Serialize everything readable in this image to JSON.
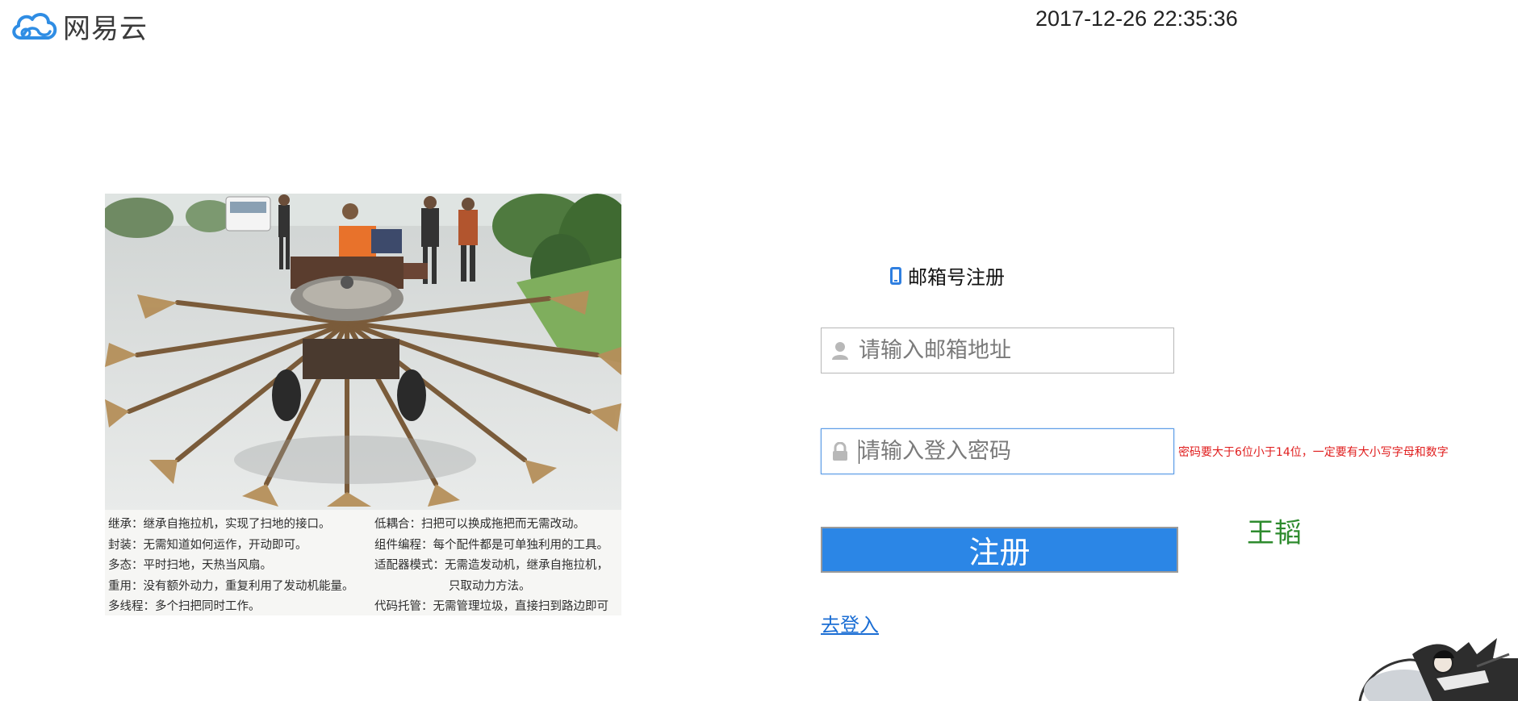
{
  "header": {
    "logo_icon": "cloud-logo-icon",
    "brand": "网易云",
    "datetime": "2017-12-26 22:35:36"
  },
  "meme": {
    "caption_left": [
      "继承：继承自拖拉机，实现了扫地的接口。",
      "封装：无需知道如何运作，开动即可。",
      "多态：平时扫地，天热当风扇。",
      "重用：没有额外动力，重复利用了发动机能量。",
      "多线程：多个扫把同时工作。"
    ],
    "caption_right": [
      "低耦合：扫把可以换成拖把而无需改动。",
      "组件编程：每个配件都是可单独利用的工具。",
      "适配器模式：无需造发动机，继承自拖拉机，",
      "只取动力方法。",
      "代码托管：无需管理垃圾，直接扫到路边即可"
    ]
  },
  "register": {
    "title_icon": "phone-icon",
    "title": "邮箱号注册",
    "email": {
      "icon": "user-icon",
      "placeholder": "请输入邮箱地址",
      "value": ""
    },
    "password": {
      "icon": "lock-icon",
      "placeholder": "请输入登入密码",
      "value": ""
    },
    "password_hint": "密码要大于6位小于14位，一定要有大小写字母和数字",
    "submit_label": "注册",
    "login_link": "去登入"
  },
  "author": "王韬",
  "colors": {
    "primary_button": "#2b86e6",
    "hint_red": "#e01d1d",
    "author_green": "#2e8b2e",
    "link_blue": "#1b6ed4",
    "brand_blue": "#2f8de4"
  }
}
